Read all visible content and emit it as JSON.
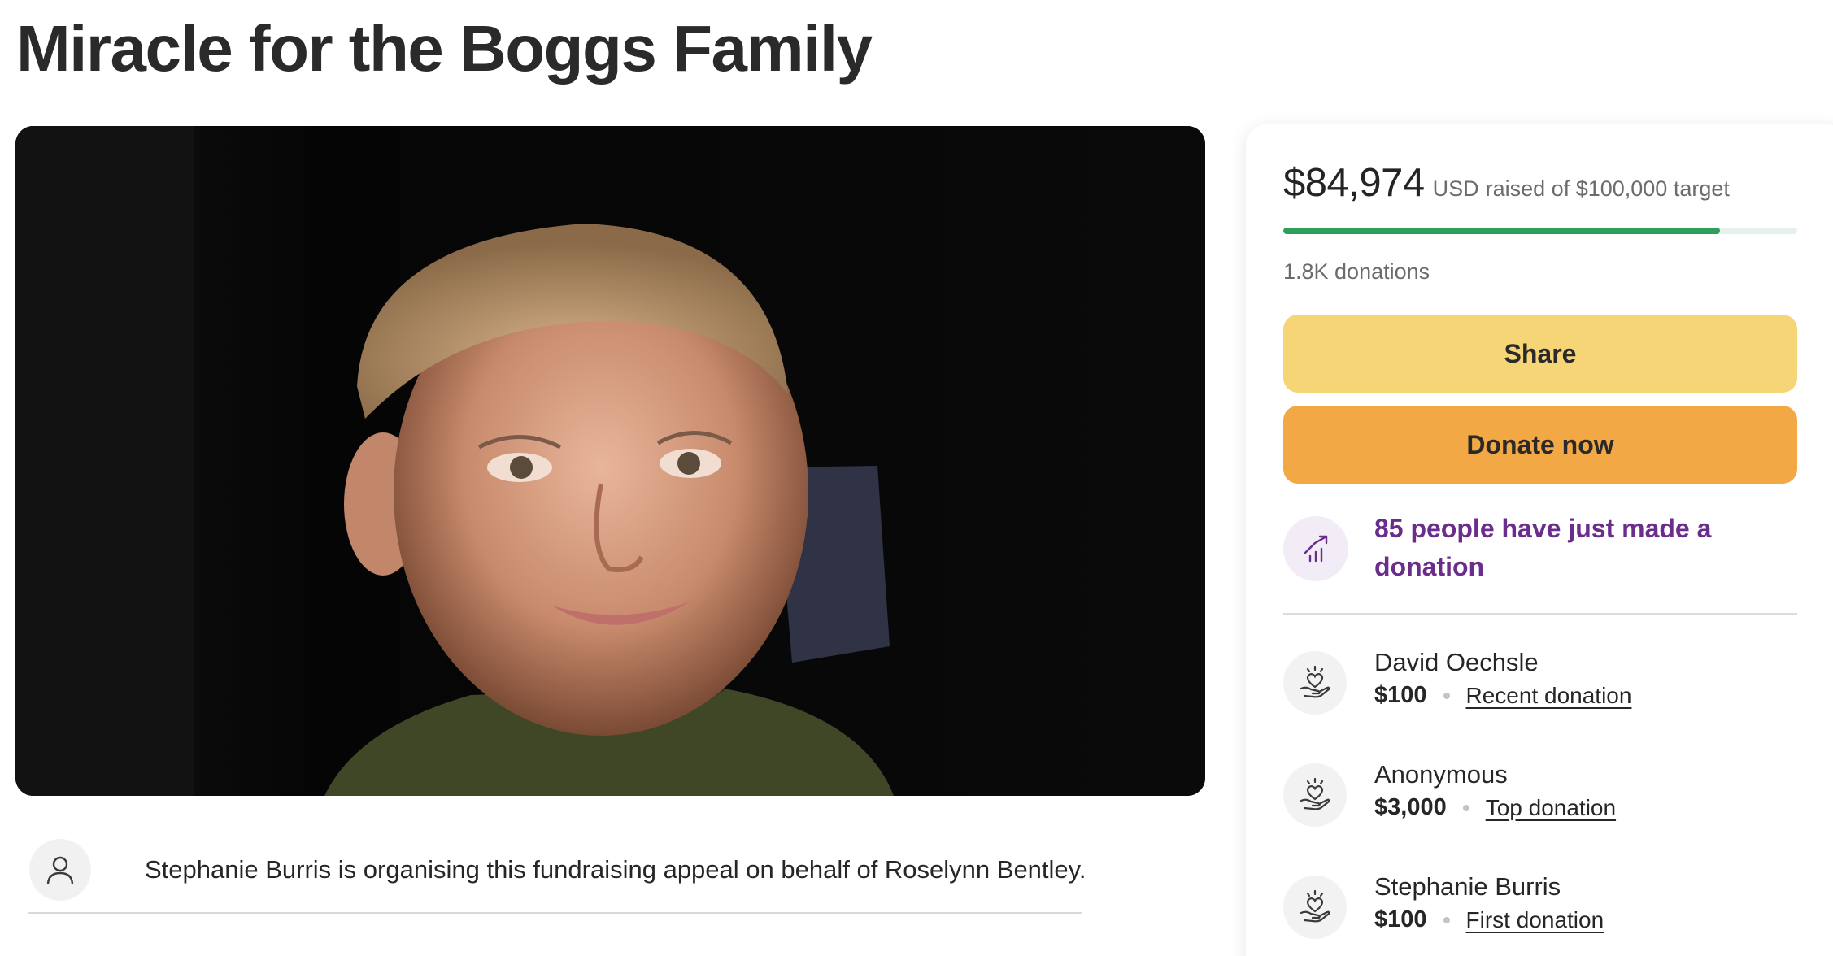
{
  "page": {
    "title": "Miracle for the Boggs Family"
  },
  "organiser": {
    "text": "Stephanie Burris is organising this fundraising appeal on behalf of Roselynn Bentley.",
    "icon": "person-icon"
  },
  "fundraiser": {
    "amount_raised": "$84,974",
    "currency": "USD",
    "target_text": "raised of $100,000 target",
    "progress_fraction": 0.85,
    "donations_count": "1.8K donations"
  },
  "actions": {
    "share_label": "Share",
    "donate_label": "Donate now"
  },
  "trend": {
    "icon": "trending-up-icon",
    "text": "85 people have just made a donation"
  },
  "donors": [
    {
      "name": "David Oechsle",
      "amount": "$100",
      "tag": "Recent donation"
    },
    {
      "name": "Anonymous",
      "amount": "$3,000",
      "tag": "Top donation"
    },
    {
      "name": "Stephanie Burris",
      "amount": "$100",
      "tag": "First donation"
    }
  ],
  "colors": {
    "progress": "#2e9e5b",
    "share_button": "#f6d576",
    "donate_button": "#f2a844",
    "trend_text": "#6b2d8b"
  }
}
